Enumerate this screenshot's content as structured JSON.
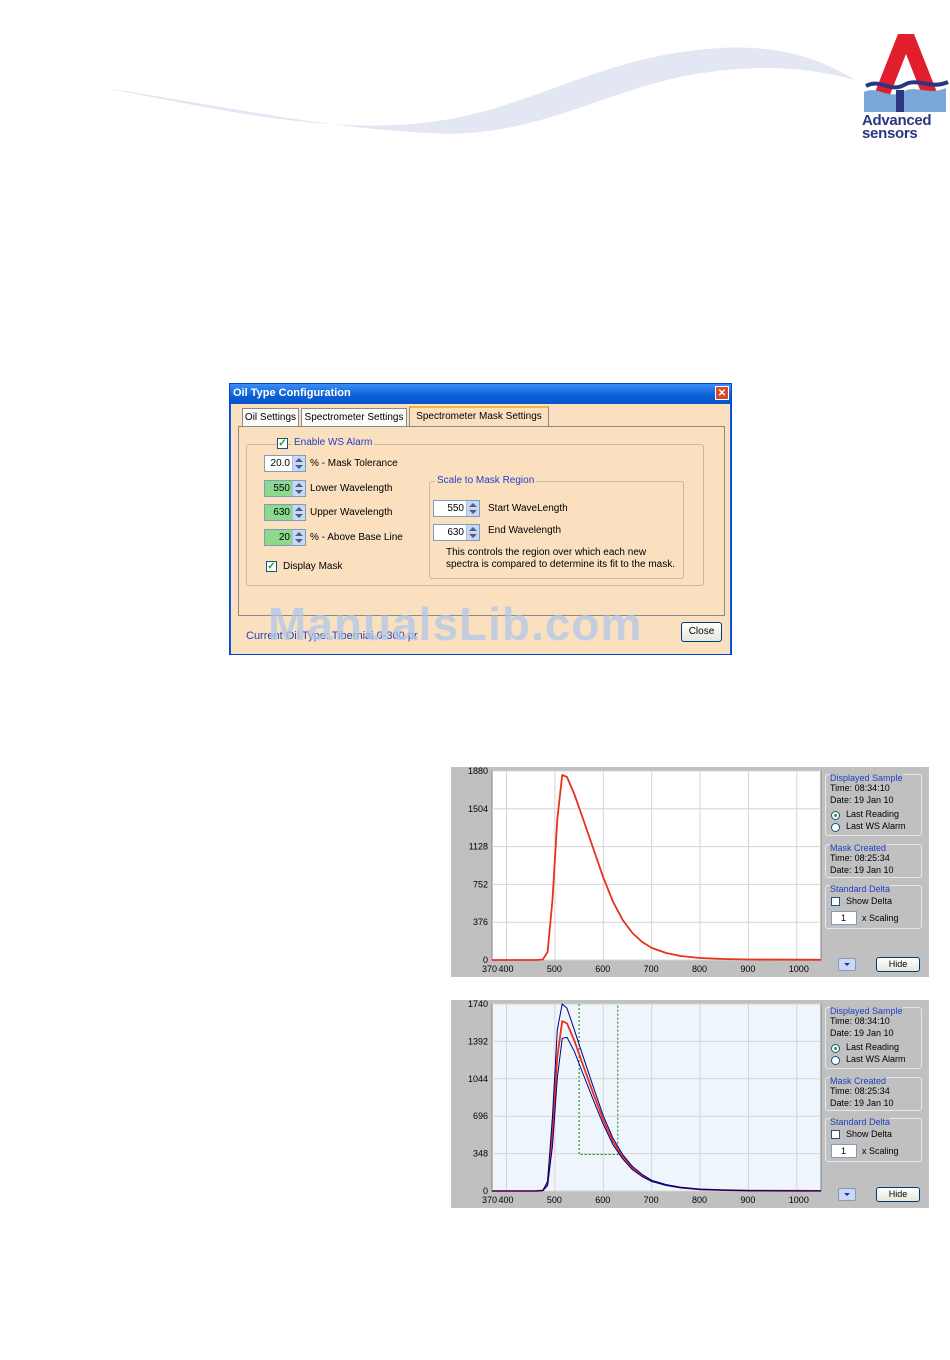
{
  "logo": {
    "line1": "Advanced",
    "line2": "sensors"
  },
  "dialog": {
    "title": "Oil Type Configuration",
    "tabs": [
      "Oil Settings",
      "Spectrometer Settings",
      "Spectrometer Mask Settings"
    ],
    "enable_ws_alarm": "Enable WS Alarm",
    "fields": {
      "mask_tolerance": {
        "value": "20.0",
        "label": "% - Mask Tolerance"
      },
      "lower_wavelength": {
        "value": "550",
        "label": "Lower Wavelength"
      },
      "upper_wavelength": {
        "value": "630",
        "label": "Upper Wavelength"
      },
      "above_base_line": {
        "value": "20",
        "label": "% - Above Base Line"
      }
    },
    "display_mask": "Display Mask",
    "scale_group": {
      "title": "Scale to Mask Region",
      "start": {
        "value": "550",
        "label": "Start WaveLength"
      },
      "end": {
        "value": "630",
        "label": "End Wavelength"
      },
      "note_line1": "This controls the region over which each new",
      "note_line2": "spectra is compared to determine its fit to the mask."
    },
    "status": "Current Oil Type: Tiberniai 0-300 pr",
    "close_label": "Close"
  },
  "watermark": "ManualsLib.com",
  "charts": [
    {
      "side": {
        "displayed_title": "Displayed Sample",
        "displayed_time": "Time: 08:34:10",
        "displayed_date": "Date: 19 Jan 10",
        "last_reading": "Last Reading",
        "last_ws_alarm": "Last WS Alarm",
        "mask_title": "Mask Created",
        "mask_time": "Time: 08:25:34",
        "mask_date": "Date: 19 Jan 10",
        "delta_title": "Standard Delta",
        "show_delta": "Show Delta",
        "scaling_value": "1",
        "scaling_label": "x Scaling",
        "hide_label": "Hide"
      }
    },
    {
      "side": {
        "displayed_title": "Displayed Sample",
        "displayed_time": "Time: 08:34:10",
        "displayed_date": "Date: 19 Jan 10",
        "last_reading": "Last Reading",
        "last_ws_alarm": "Last WS Alarm",
        "mask_title": "Mask Created",
        "mask_time": "Time: 08:25:34",
        "mask_date": "Date: 19 Jan 10",
        "delta_title": "Standard Delta",
        "show_delta": "Show Delta",
        "scaling_value": "1",
        "scaling_label": "x Scaling",
        "hide_label": "Hide"
      }
    }
  ],
  "chart_data": [
    {
      "type": "line",
      "xlim": [
        370,
        1050
      ],
      "ylim": [
        0,
        1880
      ],
      "xticks": [
        "370",
        "400",
        "500",
        "600",
        "700",
        "800",
        "900",
        "1000"
      ],
      "yticks": [
        "0",
        "376",
        "752",
        "1128",
        "1504",
        "1880"
      ],
      "grid": true,
      "series": [
        {
          "color": "#e8321e",
          "x": [
            370,
            460,
            475,
            485,
            495,
            505,
            515,
            525,
            540,
            560,
            580,
            600,
            620,
            640,
            660,
            680,
            700,
            730,
            760,
            800,
            850,
            900,
            1000,
            1050
          ],
          "y": [
            0,
            0,
            5,
            80,
            600,
            1400,
            1840,
            1820,
            1650,
            1380,
            1100,
            820,
            580,
            400,
            270,
            180,
            120,
            70,
            40,
            20,
            10,
            5,
            3,
            2
          ]
        }
      ]
    },
    {
      "type": "line",
      "xlim": [
        370,
        1050
      ],
      "ylim": [
        0,
        1740
      ],
      "xticks": [
        "370",
        "400",
        "500",
        "600",
        "700",
        "800",
        "900",
        "1000"
      ],
      "yticks": [
        "0",
        "348",
        "696",
        "1044",
        "1392",
        "1740"
      ],
      "grid": true,
      "series": [
        {
          "color": "#e8321e",
          "x": [
            370,
            460,
            475,
            485,
            495,
            505,
            515,
            525,
            540,
            560,
            580,
            600,
            620,
            640,
            660,
            680,
            700,
            730,
            760,
            800,
            850,
            900,
            1000,
            1050
          ],
          "y": [
            0,
            0,
            5,
            70,
            550,
            1250,
            1580,
            1560,
            1400,
            1150,
            900,
            660,
            460,
            320,
            215,
            145,
            95,
            55,
            32,
            15,
            8,
            4,
            2,
            1
          ]
        },
        {
          "color": "#000080",
          "x": [
            370,
            460,
            475,
            485,
            495,
            505,
            515,
            525,
            540,
            560,
            580,
            600,
            620,
            640,
            660,
            680,
            700,
            730,
            760,
            800,
            850,
            900,
            1000,
            1050
          ],
          "y": [
            0,
            0,
            5,
            90,
            700,
            1500,
            1740,
            1700,
            1500,
            1230,
            960,
            700,
            490,
            340,
            230,
            155,
            100,
            60,
            35,
            18,
            9,
            5,
            2,
            1
          ]
        },
        {
          "color": "#000080",
          "x": [
            370,
            460,
            475,
            485,
            495,
            505,
            515,
            525,
            540,
            560,
            580,
            600,
            620,
            640,
            660,
            680,
            700,
            730,
            760,
            800,
            850,
            900,
            1000,
            1050
          ],
          "y": [
            0,
            0,
            4,
            50,
            420,
            1050,
            1420,
            1430,
            1300,
            1070,
            840,
            620,
            430,
            300,
            200,
            135,
            88,
            52,
            30,
            14,
            7,
            3,
            1,
            1
          ]
        }
      ],
      "mask_region": {
        "color": "#108010",
        "x": [
          550,
          630
        ],
        "baseline": 340
      }
    }
  ]
}
